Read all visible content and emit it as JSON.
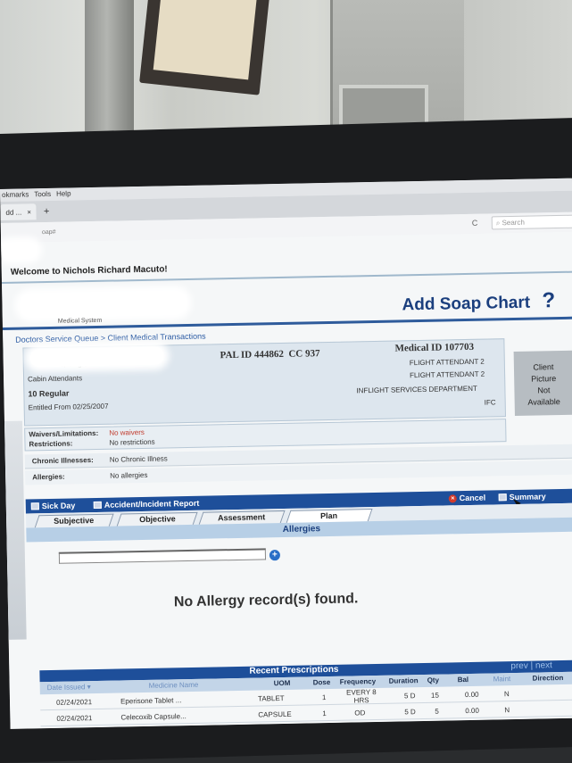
{
  "browser": {
    "menu": [
      "okmarks",
      "Tools",
      "Help"
    ],
    "tab_label": "dd ...",
    "tab_close": "×",
    "new_tab": "+",
    "url_fragment": "oap#",
    "reload": "C",
    "search_placeholder": "Search"
  },
  "header": {
    "welcome": "Welcome to Nichols Richard Macuto!",
    "title": "Add Soap Chart",
    "help": "?",
    "subsystem": "Medical System"
  },
  "breadcrumb": {
    "a": "Doctors Service Queue",
    "sep": ">",
    "b": "Client Medical Transactions"
  },
  "patient": {
    "age_status": "8, Single",
    "group": "Cabin Attendants",
    "grade": "10 Regular",
    "entitled": "Entitled From 02/25/2007",
    "pal_id": "PAL ID 444862",
    "cc": "CC 937",
    "medical_id": "Medical ID 107703",
    "position1": "FLIGHT ATTENDANT 2",
    "position2": "FLIGHT ATTENDANT 2",
    "department": "INFLIGHT SERVICES DEPARTMENT",
    "unit": "IFC",
    "picture": [
      "Client",
      "Picture",
      "Not",
      "Available"
    ]
  },
  "conditions": {
    "waivers_label": "Waivers/Limitations:",
    "waivers_value": "No waivers",
    "restrictions_label": "Restrictions:",
    "restrictions_value": "No restrictions",
    "chronic_label": "Chronic Illnesses:",
    "chronic_value": "No Chronic Illness",
    "allergies_label": "Allergies:",
    "allergies_value": "No allergies"
  },
  "actions": {
    "sick_day": "Sick Day",
    "accident": "Accident/Incident Report",
    "cancel": "Cancel",
    "summary": "Summary"
  },
  "soap_tabs": [
    "Subjective",
    "Objective",
    "Assessment",
    "Plan"
  ],
  "allergy_section": {
    "title": "Allergies",
    "add": "+",
    "empty": "No Allergy record(s) found."
  },
  "prescriptions": {
    "title": "Recent Prescriptions",
    "prev": "prev",
    "sep": "|",
    "next": "next",
    "columns": [
      "Date Issued",
      "Medicine Name",
      "UOM",
      "Dose",
      "Frequency",
      "Duration",
      "Qty",
      "Bal",
      "Maint",
      "Direction"
    ],
    "sort_indicator": "▾",
    "rows": [
      {
        "date": "02/24/2021",
        "medicine": "Eperisone Tablet ...",
        "uom": "TABLET",
        "dose": "1",
        "freq1": "EVERY 8",
        "freq2": "HRS",
        "duration": "5 D",
        "qty": "15",
        "bal": "0.00",
        "maint": "N"
      },
      {
        "date": "02/24/2021",
        "medicine": "Celecoxib Capsule...",
        "uom": "CAPSULE",
        "dose": "1",
        "freq1": "OD",
        "freq2": "",
        "duration": "5 D",
        "qty": "5",
        "bal": "0.00",
        "maint": "N"
      }
    ]
  },
  "colors": {
    "brand": "#1b3f7e",
    "bar": "#1e4f9a",
    "cancel": "#d23a2b"
  }
}
